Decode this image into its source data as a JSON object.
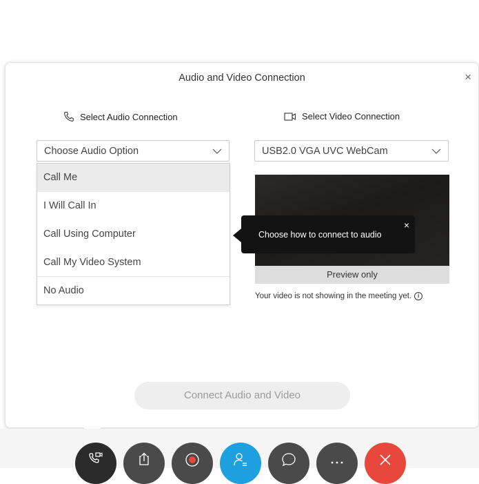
{
  "dialog": {
    "title": "Audio and Video Connection",
    "close_glyph": "×"
  },
  "audio": {
    "heading": "Select Audio Connection",
    "icon": "phone-icon",
    "selected": "Choose Audio Option",
    "options": [
      "Call Me",
      "I Will Call In",
      "Call Using Computer",
      "Call My Video System",
      "No Audio"
    ]
  },
  "video": {
    "heading": "Select Video Connection",
    "icon": "camera-icon",
    "selected": "USB2.0 VGA UVC WebCam",
    "preview_label": "Preview only",
    "status": "Your video is not showing in the meeting yet."
  },
  "tooltip": {
    "text": "Choose how to connect to audio",
    "close_glyph": "×"
  },
  "connect_button": "Connect Audio and Video",
  "toolbar": {
    "buttons": [
      {
        "name": "audio-connect",
        "icon": "phone-video-icon",
        "color": "#2b2b2b"
      },
      {
        "name": "share",
        "icon": "share-icon",
        "color": "#4a4a4a"
      },
      {
        "name": "record",
        "icon": "record-icon",
        "color": "#4a4a4a"
      },
      {
        "name": "participants",
        "icon": "participants-icon",
        "color": "#1ea0e0"
      },
      {
        "name": "chat",
        "icon": "chat-icon",
        "color": "#4a4a4a"
      },
      {
        "name": "more",
        "icon": "more-icon",
        "color": "#4a4a4a"
      },
      {
        "name": "end",
        "icon": "end-icon",
        "color": "#e8483b"
      }
    ]
  }
}
